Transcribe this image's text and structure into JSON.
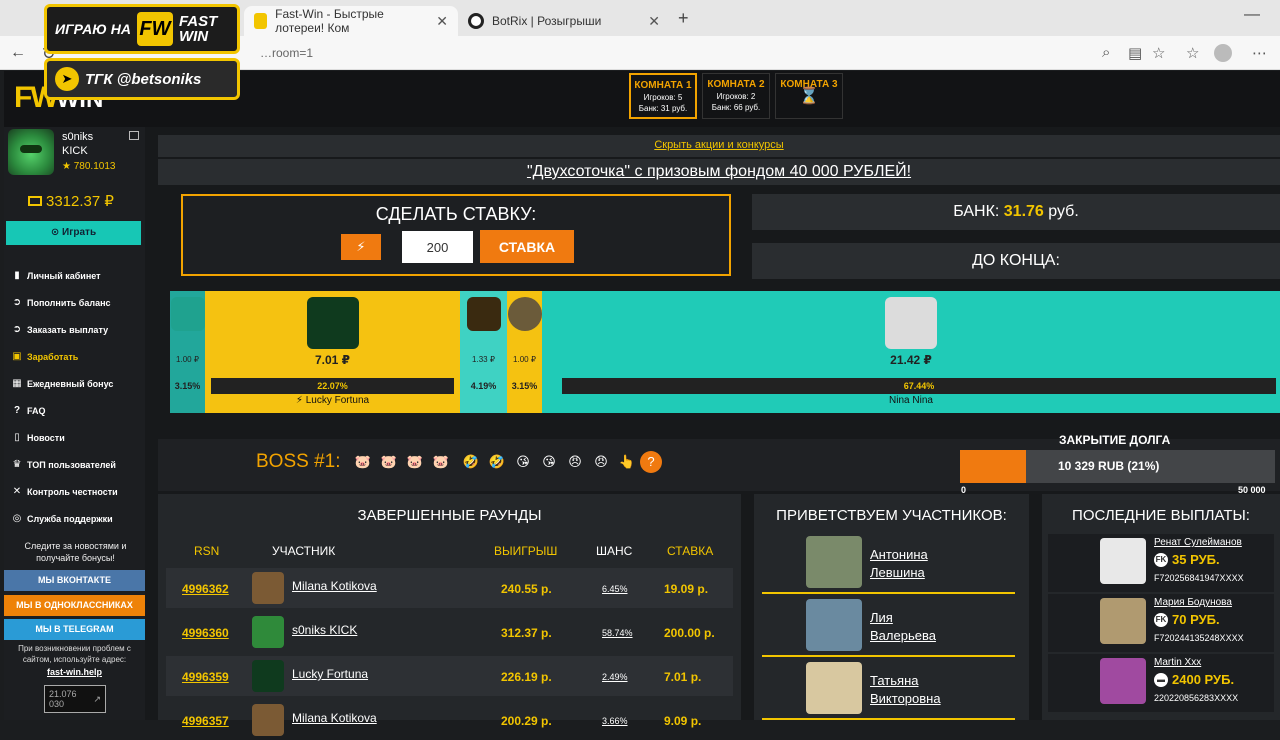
{
  "browser": {
    "tabs": [
      {
        "title": "Fast-Win - Быстрые лотереи! Ком",
        "active": true
      },
      {
        "title": "BotRix | Розыгрыши",
        "active": false
      }
    ],
    "url": "https://fast-win.ru/?room=1",
    "url_visible": "…room=1"
  },
  "promo": {
    "line1": "ИГРАЮ НА",
    "brand_fw": "FW",
    "brand_name_1": "FAST",
    "brand_name_2": "WIN",
    "line2": "ТГК @betsoniks"
  },
  "header": {
    "logo_fw": "FW",
    "logo_win": "WIN",
    "rooms": [
      {
        "title": "КОМНАТА 1",
        "players": "Игроков: 5",
        "bank": "Банк: 31 руб.",
        "active": true
      },
      {
        "title": "КОМНАТА 2",
        "players": "Игроков: 2",
        "bank": "Банк: 66 руб.",
        "active": false
      },
      {
        "title": "КОМНАТА 3",
        "hourglass": "⌛",
        "active": false
      }
    ]
  },
  "sidebar": {
    "username": "s0niks",
    "kick": "KICK",
    "rating": "★ 780.1013",
    "balance": "3312.37 ₽",
    "play_label": "⊙ Играть",
    "menu": [
      {
        "icon": "▮",
        "label": "Личный кабинет",
        "gold": false
      },
      {
        "icon": "➲",
        "label": "Пополнить баланс",
        "gold": false
      },
      {
        "icon": "➲",
        "label": "Заказать выплату",
        "gold": false
      },
      {
        "icon": "▣",
        "label": "Заработать",
        "gold": true
      },
      {
        "icon": "▦",
        "label": "Ежедневный бонус",
        "gold": false
      },
      {
        "icon": "?",
        "label": "FAQ",
        "gold": false
      },
      {
        "icon": "▯",
        "label": "Новости",
        "gold": false
      },
      {
        "icon": "♛",
        "label": "ТОП пользователей",
        "gold": false
      },
      {
        "icon": "✕",
        "label": "Контроль честности",
        "gold": false
      },
      {
        "icon": "◎",
        "label": "Служба поддержки",
        "gold": false
      }
    ],
    "news_text": "Следите за новостями и получайте бонусы!",
    "vk": "МЫ ВКОНТАКТЕ",
    "ok": "МЫ В ОДНОКЛАССНИКАХ",
    "tg": "МЫ В TELEGRAM",
    "problem_text": "При возникновении проблем с сайтом, используйте адрес:",
    "help_link": "fast-win.help",
    "qr_text": "21.076 030"
  },
  "main": {
    "hide_link": "Скрыть акции и конкурсы",
    "banner": "\"Двухсоточка\" с призовым фондом 40 000 РУБЛЕЙ!",
    "bet_title": "СДЕЛАТЬ СТАВКУ:",
    "bet_bolt": "⚡",
    "bet_value": "200",
    "stake_label": "СТАВКА",
    "bank_label": "БАНК:",
    "bank_value": "31.76",
    "bank_unit": "руб.",
    "till_label": "ДО КОНЦА:",
    "players": [
      {
        "amount": "1.00 ₽",
        "pct": "3.15%",
        "name": "",
        "color": "#22a79b",
        "share": 0.0315
      },
      {
        "amount": "7.01 ₽",
        "pct": "22.07%",
        "name": "⚡ Lucky Fortuna",
        "color": "#f5c211",
        "share": 0.2207
      },
      {
        "amount": "1.33 ₽",
        "pct": "4.19%",
        "name": "",
        "color": "#3fd2c3",
        "share": 0.0419
      },
      {
        "amount": "1.00 ₽",
        "pct": "3.15%",
        "name": "",
        "color": "#f5c211",
        "share": 0.0315
      },
      {
        "amount": "21.42 ₽",
        "pct": "67.44%",
        "name": "Nina Nina",
        "color": "#20cbb7",
        "share": 0.6744
      }
    ],
    "boss_label": "BOSS #1:",
    "boss_emojis": [
      "🐷",
      "🐷",
      "🐷",
      "🐷",
      "🤣",
      "🤣",
      "😘",
      "😘",
      "😠",
      "😠",
      "👆",
      "?"
    ],
    "debt_title": "ЗАКРЫТИЕ ДОЛГА",
    "debt_text": "10 329 RUB (21%)",
    "debt_fraction": 0.21,
    "debt_min": "0",
    "debt_max": "50 000",
    "rounds_title": "ЗАВЕРШЕННЫЕ РАУНДЫ",
    "rounds_headers": {
      "rsn": "RSN",
      "player": "УЧАСТНИК",
      "win": "ВЫИГРЫШ",
      "chance": "ШАНС",
      "stake": "СТАВКА"
    },
    "rounds": [
      {
        "id": "4996362",
        "name": "Milana Kotikova",
        "win": "240.55 р.",
        "chance": "6.45%",
        "stake": "19.09 р."
      },
      {
        "id": "4996360",
        "name": "s0niks KICK",
        "win": "312.37 р.",
        "chance": "58.74%",
        "stake": "200.00 р."
      },
      {
        "id": "4996359",
        "name": "Lucky Fortuna",
        "win": "226.19 р.",
        "chance": "2.49%",
        "stake": "7.01 р."
      },
      {
        "id": "4996357",
        "name": "Milana Kotikova",
        "win": "200.29 р.",
        "chance": "3.66%",
        "stake": "9.09 р."
      }
    ],
    "welcome_title": "ПРИВЕТСТВУЕМ УЧАСТНИКОВ:",
    "welcome": [
      {
        "line1": "Антонина",
        "line2": "Левшина"
      },
      {
        "line1": "Лия",
        "line2": "Валерьева"
      },
      {
        "line1": "Татьяна",
        "line2": "Викторовна"
      }
    ],
    "payouts_title": "ПОСЛЕДНИЕ ВЫПЛАТЫ:",
    "payouts": [
      {
        "name": "Ренат Сулейманов",
        "sum": "35 РУБ.",
        "card": "F720256841947XXXX",
        "sys": "FK"
      },
      {
        "name": "Мария Бодунова",
        "sum": "70 РУБ.",
        "card": "F720244135248XXXX",
        "sys": "FK"
      },
      {
        "name": "Martin Xxx",
        "sum": "2400 РУБ.",
        "card": "220220856283XXXX",
        "sys": "▬"
      }
    ]
  }
}
